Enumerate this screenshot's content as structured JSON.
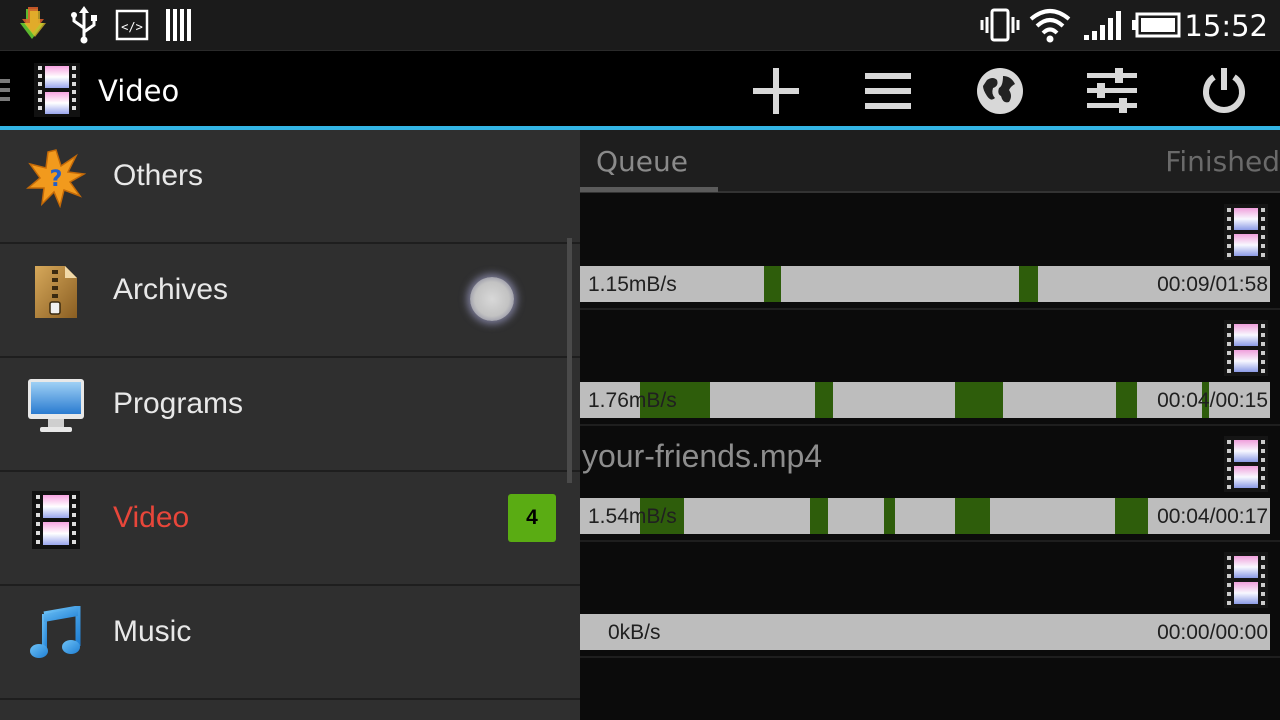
{
  "status_bar": {
    "time": "15:52",
    "left_icons": [
      "download-notification-icon",
      "usb-icon",
      "code-icon",
      "barcode-icon"
    ],
    "right_icons": [
      "vibrate-icon",
      "wifi-icon",
      "signal-icon",
      "battery-icon"
    ]
  },
  "action_bar": {
    "title": "Video",
    "icon": "video-film-icon",
    "actions": [
      "add-icon",
      "menu-list-icon",
      "globe-icon",
      "sliders-icon",
      "power-icon"
    ]
  },
  "drawer": {
    "items": [
      {
        "label": "Others",
        "icon": "others-burst-icon",
        "active": false
      },
      {
        "label": "Archives",
        "icon": "archive-zip-icon",
        "active": false
      },
      {
        "label": "Programs",
        "icon": "monitor-icon",
        "active": false
      },
      {
        "label": "Video",
        "icon": "video-film-icon",
        "active": true,
        "badge": "4"
      },
      {
        "label": "Music",
        "icon": "music-note-icon",
        "active": false
      }
    ]
  },
  "tabs": {
    "queue": "Queue",
    "finished": "Finished",
    "selected": "Queue"
  },
  "downloads": [
    {
      "name": "",
      "speed": "1.15mB/s",
      "time": "00:09/01:58",
      "segments": [
        [
          0.266,
          0.291
        ],
        [
          0.636,
          0.664
        ]
      ]
    },
    {
      "name": "",
      "speed": "1.76mB/s",
      "time": "00:04/00:15",
      "segments": [
        [
          0.087,
          0.188
        ],
        [
          0.341,
          0.367
        ],
        [
          0.544,
          0.613
        ],
        [
          0.777,
          0.807
        ],
        [
          0.901,
          0.911
        ]
      ]
    },
    {
      "name": "your-friends.mp4",
      "speed": "1.54mB/s",
      "time": "00:04/00:17",
      "segments": [
        [
          0.087,
          0.151
        ],
        [
          0.333,
          0.359
        ],
        [
          0.441,
          0.456
        ],
        [
          0.544,
          0.594
        ],
        [
          0.775,
          0.823
        ]
      ]
    },
    {
      "name": "",
      "speed": "0kB/s",
      "time": "00:00/00:00",
      "segments": []
    }
  ],
  "colors": {
    "accent": "#33b5e5",
    "active_drawer_text": "#e8463a",
    "badge": "#5aac13",
    "progress_segment": "#2e5d0b",
    "progress_bg": "#bdbdbd"
  }
}
